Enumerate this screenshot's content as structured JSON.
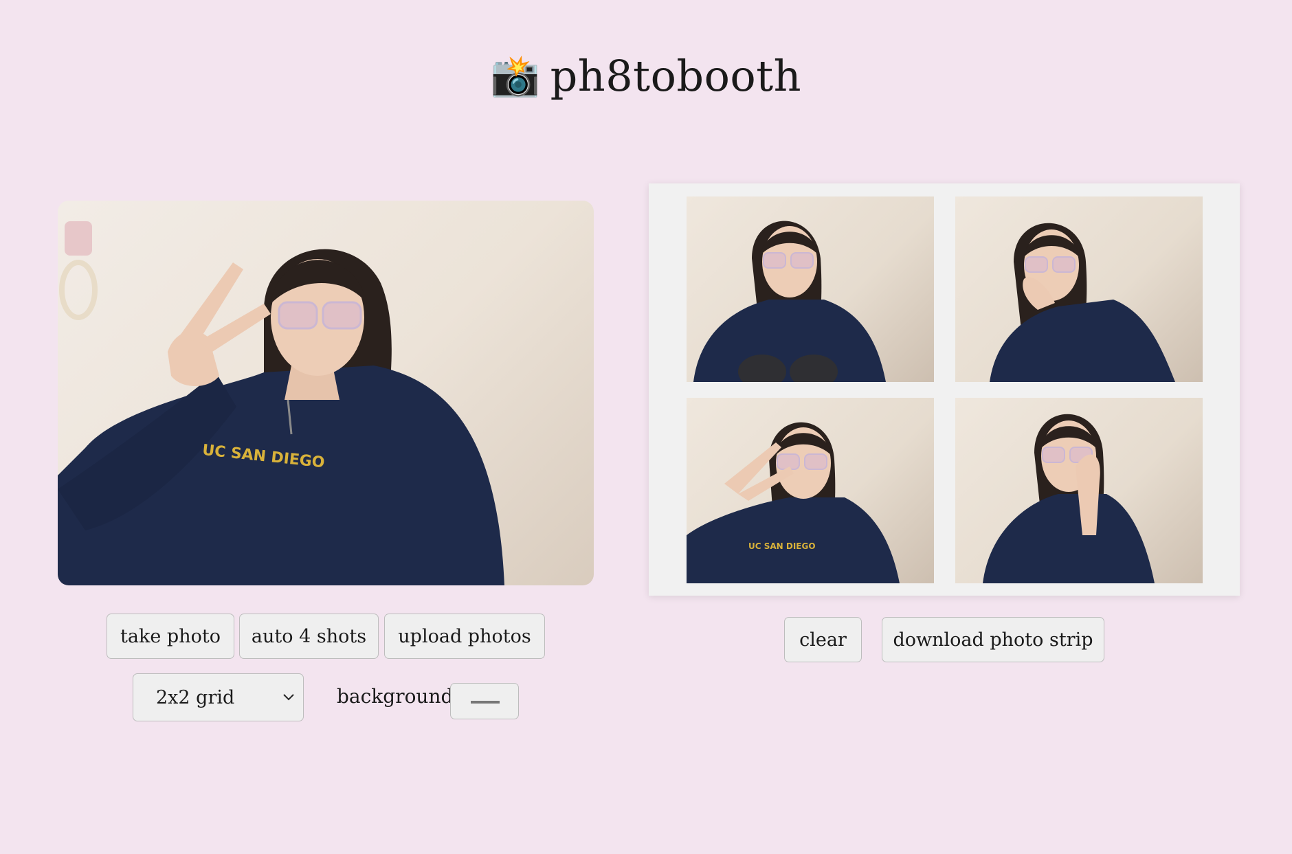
{
  "header": {
    "icon": "camera-flash-icon",
    "icon_glyph": "📸",
    "title": "ph8tobooth"
  },
  "camera": {
    "buttons": {
      "take_photo": "take photo",
      "auto_shots": "auto 4 shots",
      "upload": "upload photos"
    },
    "layout_select": {
      "value": "2x2 grid"
    },
    "background": {
      "label": "background:"
    }
  },
  "strip": {
    "photos": [
      {
        "pose": "sitting"
      },
      {
        "pose": "chin-rest"
      },
      {
        "pose": "peace-sign"
      },
      {
        "pose": "hand-on-face"
      }
    ],
    "buttons": {
      "clear": "clear",
      "download": "download photo strip"
    }
  },
  "colors": {
    "page_bg": "#f3e4ef",
    "button_bg": "#efefef",
    "strip_bg": "#f1f1f1",
    "hoodie": "#1e2a4a",
    "hair": "#2a211d"
  }
}
